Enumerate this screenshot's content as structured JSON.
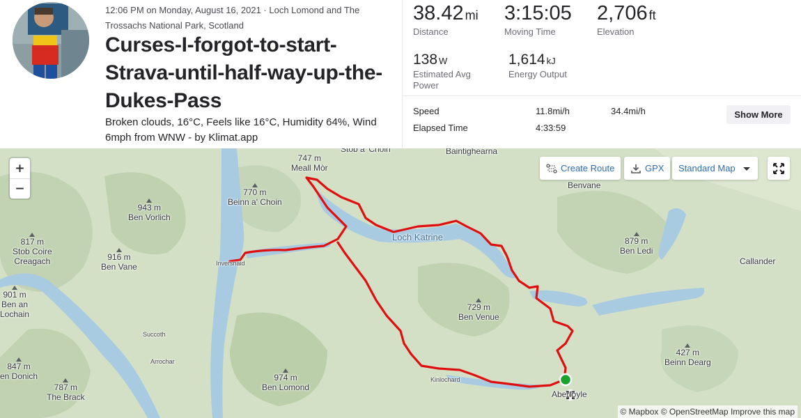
{
  "activity": {
    "meta": "12:06 PM on Monday, August 16, 2021 · Loch Lomond and The Trossachs National Park, Scotland",
    "title": "Curses-I-forgot-to-start-Strava-until-half-way-up-the-Dukes-Pass",
    "description": "Broken clouds, 16°C, Feels like 16°C, Humidity 64%, Wind 6mph from WNW - by Klimat.app"
  },
  "stats": {
    "distance": {
      "value": "38.42",
      "unit": "mi",
      "label": "Distance"
    },
    "moving_time": {
      "value": "3:15:05",
      "label": "Moving Time"
    },
    "elevation": {
      "value": "2,706",
      "unit": "ft",
      "label": "Elevation"
    },
    "power": {
      "value": "138",
      "unit": "W",
      "label": "Estimated Avg Power"
    },
    "energy": {
      "value": "1,614",
      "unit": "kJ",
      "label": "Energy Output"
    },
    "speed": {
      "label": "Speed",
      "avg": "11.8mi/h",
      "max": "34.4mi/h"
    },
    "elapsed": {
      "label": "Elapsed Time",
      "value": "4:33:59"
    },
    "show_more_label": "Show More"
  },
  "map": {
    "controls": {
      "zoom_in": "+",
      "zoom_out": "−",
      "create_route": "Create Route",
      "gpx": "GPX",
      "map_style": "Standard Map"
    },
    "labels": [
      {
        "id": "stob-a-choin",
        "text": "Stob a' Choin"
      },
      {
        "id": "baintighearna",
        "text": "Baintighearna"
      },
      {
        "id": "meall-mor",
        "elev": "747 m",
        "text": "Meall Mòr"
      },
      {
        "id": "beinn-a-choin",
        "elev": "770 m",
        "text": "Beinn a' Choin"
      },
      {
        "id": "ben-vorlich",
        "elev": "943 m",
        "text": "Ben Vorlich"
      },
      {
        "id": "stob-coire",
        "elev": "817 m",
        "text": "Stob Coire"
      },
      {
        "id": "creagach",
        "text": "Creagach"
      },
      {
        "id": "ben-vane",
        "elev": "916 m",
        "text": "Ben Vane"
      },
      {
        "id": "inversnaid",
        "text": "Inversnaid"
      },
      {
        "id": "loch-katrine",
        "text": "Loch Katrine"
      },
      {
        "id": "benvane",
        "text": "Benvane"
      },
      {
        "id": "ben-ledi",
        "elev": "879 m",
        "text": "Ben Ledi"
      },
      {
        "id": "callander",
        "text": "Callander"
      },
      {
        "id": "ben-an-lochain",
        "elev": "901 m",
        "text": "Ben an"
      },
      {
        "id": "lochain",
        "text": "Lochain"
      },
      {
        "id": "ben-venue",
        "elev": "729 m",
        "text": "Ben Venue"
      },
      {
        "id": "succoth",
        "text": "Succoth"
      },
      {
        "id": "arrochar",
        "text": "Arrochar"
      },
      {
        "id": "ben-donich",
        "elev": "847 m",
        "text": "en Donich"
      },
      {
        "id": "the-brack",
        "elev": "787 m",
        "text": "The Brack"
      },
      {
        "id": "ben-lomond",
        "elev": "974 m",
        "text": "Ben Lomond"
      },
      {
        "id": "kinlochard",
        "text": "Kinlochard"
      },
      {
        "id": "aberfoyle",
        "text": "Aberfoyle"
      },
      {
        "id": "beinn-dearg",
        "elev": "427 m",
        "text": "Beinn Dearg"
      }
    ],
    "attribution": {
      "mapbox": "© Mapbox",
      "osm": "© OpenStreetMap",
      "improve": "Improve this map"
    },
    "colors": {
      "route": "#e00f0f",
      "start_marker": "#1aa32c",
      "water": "#a8cbe2",
      "land": "#d3e0c6"
    }
  }
}
